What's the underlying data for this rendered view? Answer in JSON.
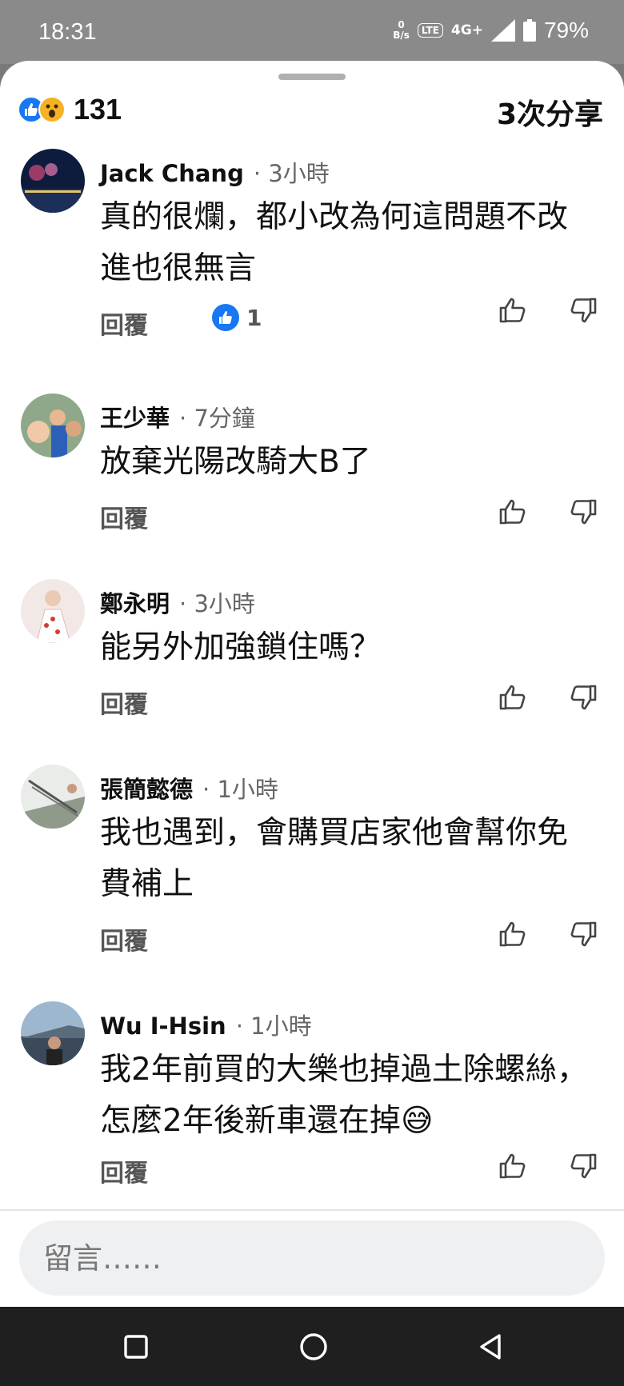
{
  "status_bar": {
    "time": "18:31",
    "net_speed_value": "0",
    "net_speed_unit": "B/s",
    "volte": "LTE",
    "network": "4G+",
    "battery": "79%"
  },
  "header": {
    "reaction_count": "131",
    "shares": "3次分享",
    "reaction_icons": [
      "like-icon",
      "wow-icon"
    ]
  },
  "colors": {
    "like_blue": "#1877f2",
    "wow_yellow": "#f7b125"
  },
  "comments": [
    {
      "name": "Jack Chang",
      "time": "· 3小時",
      "text": "真的很爛，都小改為何這問題不改進也很無言",
      "reply": "回覆",
      "likes": "1"
    },
    {
      "name": "王少華",
      "time": "· 7分鐘",
      "text": "放棄光陽改騎大B了",
      "reply": "回覆"
    },
    {
      "name": "鄭永明",
      "time": "· 3小時",
      "text": "能另外加強鎖住嗎？",
      "reply": "回覆"
    },
    {
      "name": "張簡懿德",
      "time": "· 1小時",
      "text": "我也遇到，會購買店家他會幫你免費補上",
      "reply": "回覆"
    },
    {
      "name": "Wu I-Hsin",
      "time": "· 1小時",
      "text": "我2年前買的大樂也掉過土除螺絲，怎麼2年後新車還在掉😅",
      "reply": "回覆"
    }
  ],
  "composer": {
    "placeholder": "留言……"
  },
  "nav": {
    "buttons": [
      "recents-square-icon",
      "home-circle-icon",
      "back-triangle-icon"
    ]
  }
}
